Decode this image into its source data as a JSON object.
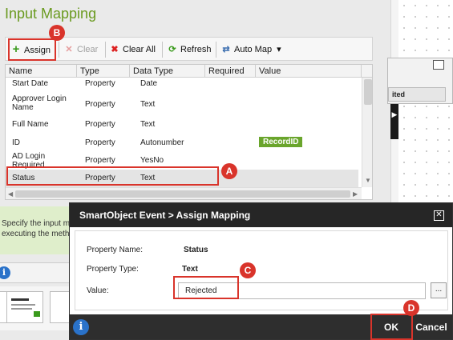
{
  "page": {
    "title": "Input Mapping"
  },
  "toolbar": {
    "assign": "Assign",
    "clear": "Clear",
    "clear_all": "Clear All",
    "refresh": "Refresh",
    "auto_map": "Auto Map",
    "auto_map_arrow": "▾"
  },
  "grid": {
    "headers": {
      "name": "Name",
      "type": "Type",
      "data_type": "Data Type",
      "required": "Required",
      "value": "Value"
    },
    "rows": [
      {
        "name": "Start Date",
        "type": "Property",
        "data_type": "Date",
        "required": "",
        "value": ""
      },
      {
        "name": "Approver Login Name",
        "type": "Property",
        "data_type": "Text",
        "required": "",
        "value": ""
      },
      {
        "name": "Full Name",
        "type": "Property",
        "data_type": "Text",
        "required": "",
        "value": ""
      },
      {
        "name": "ID",
        "type": "Property",
        "data_type": "Autonumber",
        "required": "",
        "value": "RecordID"
      },
      {
        "name": "AD Login Required",
        "type": "Property",
        "data_type": "YesNo",
        "required": "",
        "value": ""
      },
      {
        "name": "Status",
        "type": "Property",
        "data_type": "Text",
        "required": "",
        "value": ""
      }
    ]
  },
  "left_info": {
    "text_line1": "Specify the input ma",
    "text_line2": "executing the metho",
    "icon": "i"
  },
  "right_panel": {
    "collapse_glyph": "▶",
    "mini_window_text": "ited"
  },
  "dialog": {
    "title": "SmartObject Event > Assign Mapping",
    "close_glyph": "✕",
    "property_name_label": "Property Name:",
    "property_name_value": "Status",
    "property_type_label": "Property Type:",
    "property_type_value": "Text",
    "value_label": "Value:",
    "value_input": "Rejected",
    "ellipsis": "...",
    "ok": "OK",
    "cancel": "Cancel",
    "info_icon": "i"
  },
  "callouts": {
    "a": "A",
    "b": "B",
    "c": "C",
    "d": "D"
  },
  "colors": {
    "accent_green": "#6a9a1f",
    "callout_red": "#d9342b",
    "badge_green": "#6aa52c",
    "dialog_dark": "#262626"
  }
}
